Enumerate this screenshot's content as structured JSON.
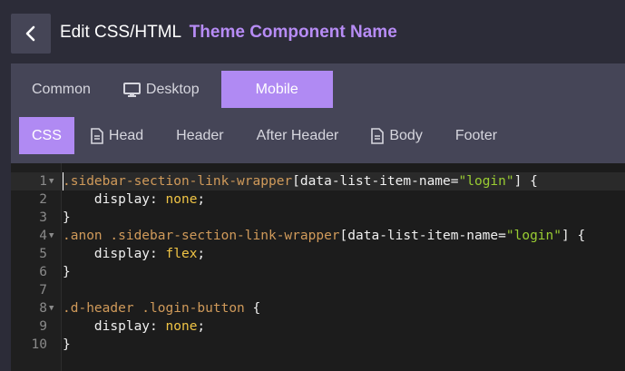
{
  "header": {
    "title_prefix": "Edit CSS/HTML",
    "component_name": "Theme Component Name",
    "back_icon": "chevron-left-icon"
  },
  "device_tabs": [
    {
      "label": "Common",
      "icon": null,
      "active": false
    },
    {
      "label": "Desktop",
      "icon": "desktop-icon",
      "active": false
    },
    {
      "label": "Mobile",
      "icon": null,
      "active": true
    }
  ],
  "section_tabs": [
    {
      "label": "CSS",
      "icon": null,
      "active": true
    },
    {
      "label": "Head",
      "icon": "file-icon",
      "active": false
    },
    {
      "label": "Header",
      "icon": null,
      "active": false
    },
    {
      "label": "After Header",
      "icon": null,
      "active": false
    },
    {
      "label": "Body",
      "icon": "file-icon",
      "active": false
    },
    {
      "label": "Footer",
      "icon": null,
      "active": false
    }
  ],
  "editor": {
    "language": "css",
    "active_line": 1,
    "lines": [
      {
        "number": "1",
        "fold": true,
        "tokens": [
          {
            "t": "sel",
            "v": ".sidebar-section-link-wrapper"
          },
          {
            "t": "plain",
            "v": "[data-list-item-name="
          },
          {
            "t": "str",
            "v": "\"login\""
          },
          {
            "t": "plain",
            "v": "] {"
          }
        ]
      },
      {
        "number": "2",
        "fold": false,
        "tokens": [
          {
            "t": "plain",
            "v": "    display: "
          },
          {
            "t": "val",
            "v": "none"
          },
          {
            "t": "plain",
            "v": ";"
          }
        ]
      },
      {
        "number": "3",
        "fold": false,
        "tokens": [
          {
            "t": "plain",
            "v": "}"
          }
        ]
      },
      {
        "number": "4",
        "fold": true,
        "tokens": [
          {
            "t": "sel",
            "v": ".anon .sidebar-section-link-wrapper"
          },
          {
            "t": "plain",
            "v": "[data-list-item-name="
          },
          {
            "t": "str",
            "v": "\"login\""
          },
          {
            "t": "plain",
            "v": "] {"
          }
        ]
      },
      {
        "number": "5",
        "fold": false,
        "tokens": [
          {
            "t": "plain",
            "v": "    display: "
          },
          {
            "t": "val",
            "v": "flex"
          },
          {
            "t": "plain",
            "v": ";"
          }
        ]
      },
      {
        "number": "6",
        "fold": false,
        "tokens": [
          {
            "t": "plain",
            "v": "}"
          }
        ]
      },
      {
        "number": "7",
        "fold": false,
        "tokens": []
      },
      {
        "number": "8",
        "fold": true,
        "tokens": [
          {
            "t": "sel",
            "v": ".d-header .login-button"
          },
          {
            "t": "plain",
            "v": " {"
          }
        ]
      },
      {
        "number": "9",
        "fold": false,
        "tokens": [
          {
            "t": "plain",
            "v": "    display: "
          },
          {
            "t": "val",
            "v": "none"
          },
          {
            "t": "plain",
            "v": ";"
          }
        ]
      },
      {
        "number": "10",
        "fold": false,
        "tokens": [
          {
            "t": "plain",
            "v": "}"
          }
        ]
      }
    ]
  },
  "colors": {
    "accent": "#b08af3",
    "component_name": "#b78cf5",
    "selector": "#d09a5a",
    "string": "#9acd32",
    "value": "#f0c445"
  }
}
